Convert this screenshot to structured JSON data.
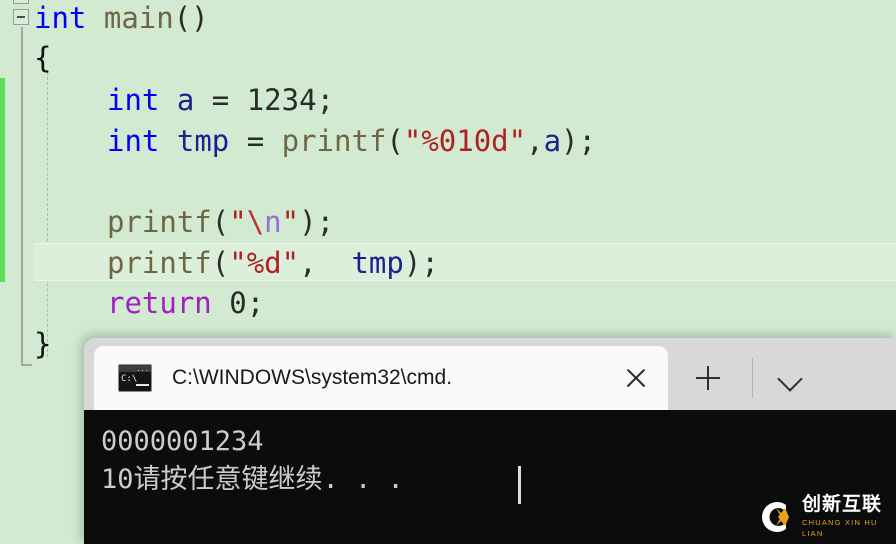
{
  "editor": {
    "background_color": "#d2ead1",
    "current_line_highlight_color": "#dcefda",
    "change_bar_color": "#5ddd5d",
    "colors": {
      "keyword_type": "#0000ff",
      "keyword_control": "#a020c0",
      "string": "#b02020",
      "escape_char": "#9370db",
      "function": "#6f6646",
      "identifier": "#1f1f8f",
      "plain": "#2b2b2b"
    },
    "collapse_icon": "minus-square-icon",
    "lines": [
      {
        "id": "line-main",
        "tokens": [
          {
            "text": "int",
            "cls": "kw-type"
          },
          {
            "text": " ",
            "cls": "plain"
          },
          {
            "text": "main",
            "cls": "fn"
          },
          {
            "text": "()",
            "cls": "punct"
          }
        ]
      },
      {
        "id": "line-open-brace",
        "tokens": [
          {
            "text": "{",
            "cls": "brace"
          }
        ]
      },
      {
        "id": "line-int-a",
        "tokens": [
          {
            "text": "int",
            "cls": "kw-type"
          },
          {
            "text": " ",
            "cls": "plain"
          },
          {
            "text": "a",
            "cls": "ident"
          },
          {
            "text": " = ",
            "cls": "plain"
          },
          {
            "text": "1234",
            "cls": "plain"
          },
          {
            "text": ";",
            "cls": "punct"
          }
        ]
      },
      {
        "id": "line-int-tmp",
        "tokens": [
          {
            "text": "int",
            "cls": "kw-type"
          },
          {
            "text": " ",
            "cls": "plain"
          },
          {
            "text": "tmp",
            "cls": "ident"
          },
          {
            "text": " = ",
            "cls": "plain"
          },
          {
            "text": "printf",
            "cls": "fn"
          },
          {
            "text": "(",
            "cls": "punct"
          },
          {
            "text": "\"%010d\"",
            "cls": "str"
          },
          {
            "text": ",",
            "cls": "punct"
          },
          {
            "text": "a",
            "cls": "ident"
          },
          {
            "text": ")",
            "cls": "punct"
          },
          {
            "text": ";",
            "cls": "punct"
          }
        ]
      },
      {
        "id": "line-blank",
        "tokens": []
      },
      {
        "id": "line-printf-newline",
        "tokens": [
          {
            "text": "printf",
            "cls": "fn"
          },
          {
            "text": "(",
            "cls": "punct"
          },
          {
            "text": "\"",
            "cls": "str"
          },
          {
            "text": "\\",
            "cls": "esc-slash"
          },
          {
            "text": "n",
            "cls": "esc-char"
          },
          {
            "text": "\"",
            "cls": "str"
          },
          {
            "text": ")",
            "cls": "punct"
          },
          {
            "text": ";",
            "cls": "punct"
          }
        ]
      },
      {
        "id": "line-printf-tmp",
        "tokens": [
          {
            "text": "printf",
            "cls": "fn"
          },
          {
            "text": "(",
            "cls": "punct"
          },
          {
            "text": "\"%d\"",
            "cls": "str"
          },
          {
            "text": ", ",
            "cls": "punct"
          },
          {
            "text": " tmp",
            "cls": "ident"
          },
          {
            "text": ")",
            "cls": "punct"
          },
          {
            "text": ";",
            "cls": "punct"
          }
        ]
      },
      {
        "id": "line-return",
        "tokens": [
          {
            "text": "return",
            "cls": "kw-ctrl"
          },
          {
            "text": " 0",
            "cls": "plain"
          },
          {
            "text": ";",
            "cls": "punct"
          }
        ]
      },
      {
        "id": "line-close-brace",
        "tokens": [
          {
            "text": "}",
            "cls": "brace"
          }
        ]
      }
    ]
  },
  "terminal": {
    "tab": {
      "title": "C:\\WINDOWS\\system32\\cmd.",
      "icon": "cmd-console-icon",
      "icon_prompt_text": "C:\\",
      "icon_dots_text": "...",
      "close_icon": "close-icon"
    },
    "new_tab_icon": "plus-icon",
    "dropdown_icon": "chevron-down-icon",
    "titlebar_color": "#d8d8d8",
    "active_tab_color": "#fafafa",
    "body_color": "#0c0c0c",
    "text_color": "#cccccc",
    "output": [
      "0000001234",
      "10请按任意键继续. . ."
    ]
  },
  "watermark": {
    "logo": "cx-logo-icon",
    "chinese": "创新互联",
    "pinyin": "CHUANG XIN HU LIAN",
    "accent_color": "#e8a31a",
    "background_color": "#0b0b0b"
  }
}
